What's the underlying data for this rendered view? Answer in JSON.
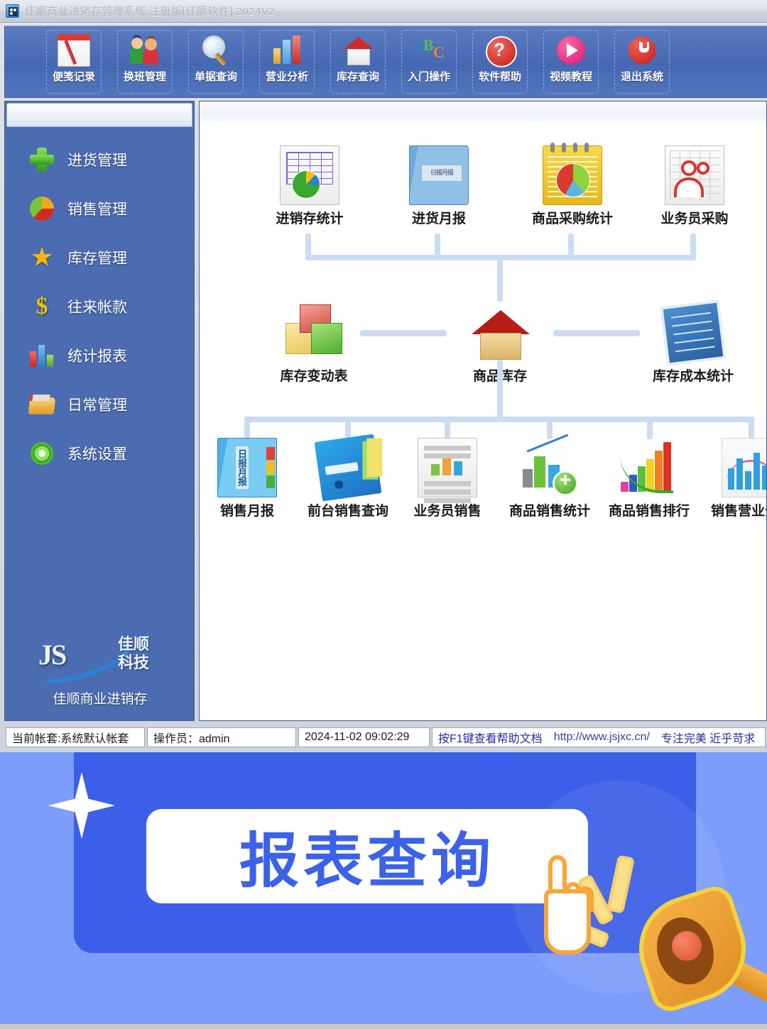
{
  "window": {
    "title": "佳顺商业进销存管理系统 注册版[佳顺软件] 2024V2",
    "app_icon": "app-icon"
  },
  "toolbar": {
    "buttons": [
      {
        "label": "便笺记录",
        "icon": "notepad-pencil-icon"
      },
      {
        "label": "换班管理",
        "icon": "two-users-icon"
      },
      {
        "label": "单据查询",
        "icon": "magnifier-icon"
      },
      {
        "label": "营业分析",
        "icon": "bar-chart-icon"
      },
      {
        "label": "库存查询",
        "icon": "house-icon"
      },
      {
        "label": "入门操作",
        "icon": "abc-letters-icon"
      },
      {
        "label": "软件帮助",
        "icon": "question-mark-icon"
      },
      {
        "label": "视频教程",
        "icon": "play-circle-icon"
      },
      {
        "label": "退出系统",
        "icon": "power-off-icon"
      }
    ]
  },
  "sidebar": {
    "items": [
      {
        "label": "进货管理",
        "icon": "green-plus-icon"
      },
      {
        "label": "销售管理",
        "icon": "pie-chart-icon"
      },
      {
        "label": "库存管理",
        "icon": "star-icon"
      },
      {
        "label": "往来帐款",
        "icon": "dollar-icon"
      },
      {
        "label": "统计报表",
        "icon": "bar-chart-icon"
      },
      {
        "label": "日常管理",
        "icon": "folder-icon"
      },
      {
        "label": "系统设置",
        "icon": "gear-icon"
      }
    ],
    "logo": {
      "mark": "JS",
      "brand_cn": "佳顺\n科技",
      "caption": "佳顺商业进销存"
    }
  },
  "workflow": {
    "row_top": [
      {
        "label": "进销存统计",
        "icon": "grid-pie-report-icon"
      },
      {
        "label": "进货月报",
        "icon": "blue-book-icon"
      },
      {
        "label": "商品采购统计",
        "icon": "notepad-pie-icon"
      },
      {
        "label": "业务员采购",
        "icon": "people-sheet-icon"
      }
    ],
    "row_middle": [
      {
        "label": "库存变动表",
        "icon": "boxes-icon"
      },
      {
        "label": "商品库存",
        "icon": "warehouse-house-icon"
      },
      {
        "label": "库存成本统计",
        "icon": "checklist-monitor-icon"
      }
    ],
    "row_bottom": [
      {
        "label": "销售月报",
        "icon": "sales-binder-icon"
      },
      {
        "label": "前台销售查询",
        "icon": "blue-folder-icon"
      },
      {
        "label": "业务员销售",
        "icon": "report-docs-icon"
      },
      {
        "label": "商品销售统计",
        "icon": "chart-plus-icon"
      },
      {
        "label": "商品销售排行",
        "icon": "success-bars-icon"
      },
      {
        "label": "销售营业分析",
        "icon": "histogram-icon"
      }
    ]
  },
  "statusbar": {
    "account_set": "当前帐套:系统默认帐套",
    "operator": "操作员：admin",
    "datetime": "2024-11-02 09:02:29",
    "help_hint": "按F1键查看帮助文档",
    "url": "http://www.jsjxc.cn/",
    "slogan": "专注完美 近乎苛求"
  },
  "banner": {
    "headline": "报表查询",
    "sparkle_icon": "sparkle-icon",
    "cursor_icon": "hand-cursor-icon",
    "megaphone_icon": "megaphone-icon",
    "colors": {
      "background": "#7d9dfa",
      "card": "#3b5fe8",
      "text": "#3b62e8",
      "accent": "#f7b24a"
    }
  }
}
